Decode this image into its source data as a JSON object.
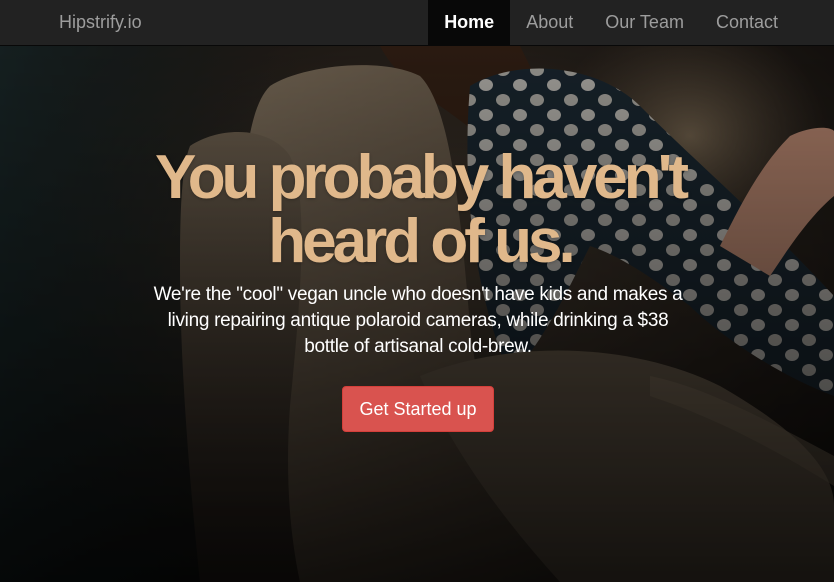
{
  "navbar": {
    "brand": "Hipstrify.io",
    "links": [
      {
        "label": "Home",
        "active": true
      },
      {
        "label": "About",
        "active": false
      },
      {
        "label": "Our Team",
        "active": false
      },
      {
        "label": "Contact",
        "active": false
      }
    ]
  },
  "hero": {
    "headline_line1": "You probaby haven't",
    "headline_line2": "heard of us.",
    "subtext": "We're the \"cool\" vegan uncle who doesn't have kids and makes a living repairing antique polaroid cameras, while drinking a $38 bottle of artisanal cold-brew.",
    "cta_label": "Get Started up"
  },
  "colors": {
    "navbar_bg": "#222222",
    "nav_active_bg": "#080808",
    "headline": "#e0b88b",
    "cta": "#d9534f"
  }
}
